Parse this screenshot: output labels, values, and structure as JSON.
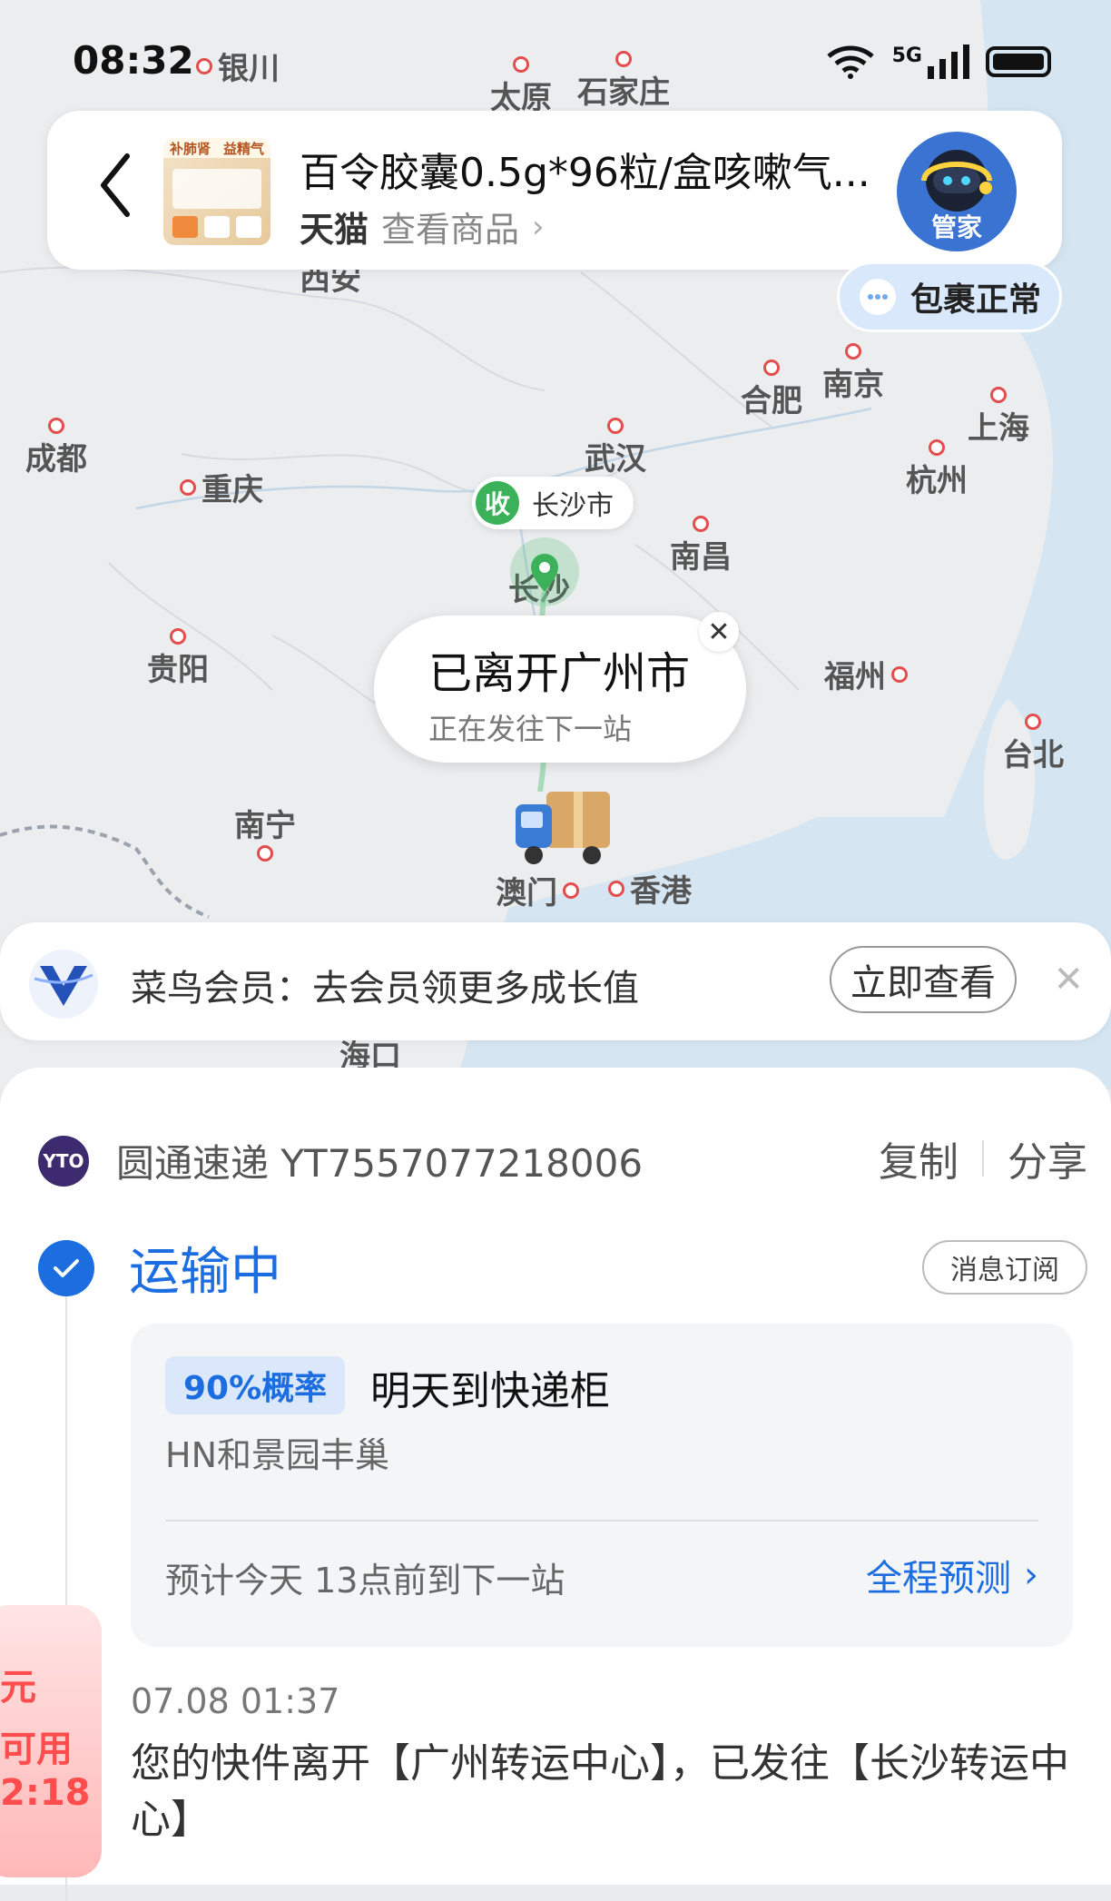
{
  "status_bar": {
    "time": "08:32",
    "network": "5G"
  },
  "product": {
    "title": "百令胶囊0.5g*96粒/盒咳嗽气...",
    "shop": "天猫",
    "view_label": "查看商品",
    "thumb_text_1": "补肺肾",
    "thumb_text_2": "益精气",
    "butler_label": "管家"
  },
  "package_chip": {
    "label": "包裹正常"
  },
  "map": {
    "cities": [
      {
        "name": "银川"
      },
      {
        "name": "太原"
      },
      {
        "name": "石家庄"
      },
      {
        "name": "西安"
      },
      {
        "name": "合肥"
      },
      {
        "name": "南京"
      },
      {
        "name": "上海"
      },
      {
        "name": "杭州"
      },
      {
        "name": "成都"
      },
      {
        "name": "重庆"
      },
      {
        "name": "武汉"
      },
      {
        "name": "南昌"
      },
      {
        "name": "长沙"
      },
      {
        "name": "贵阳"
      },
      {
        "name": "福州"
      },
      {
        "name": "台北"
      },
      {
        "name": "南宁"
      },
      {
        "name": "澳门"
      },
      {
        "name": "香港"
      },
      {
        "name": "海口"
      }
    ],
    "receiver_badge": "收",
    "receiver_city": "长沙市",
    "bubble_title": "已离开广州市",
    "bubble_sub": "正在发往下一站"
  },
  "member_banner": {
    "text": "菜鸟会员：去会员领更多成长值",
    "button": "立即查看"
  },
  "courier": {
    "name_and_number": "圆通速递 YT7557077218006",
    "copy": "复制",
    "share": "分享",
    "logo_text": "YTO"
  },
  "status": {
    "label": "运输中",
    "subscribe": "消息订阅"
  },
  "prediction": {
    "probability": "90%概率",
    "arrive": "明天到快递柜",
    "location": "HN和景园丰巢",
    "eta": "预计今天 13点前到下一站",
    "full_link": "全程预测"
  },
  "events": [
    {
      "time": "07.08 01:37",
      "desc": "您的快件离开【广州转运中心】，已发往【长沙转运中心】"
    }
  ],
  "coupon": {
    "line1": "元",
    "line2": "可用",
    "line3": "2:18"
  },
  "colors": {
    "accent": "#1c6ee0",
    "sea": "#d5e6f2",
    "map_bg": "#ebedef"
  }
}
